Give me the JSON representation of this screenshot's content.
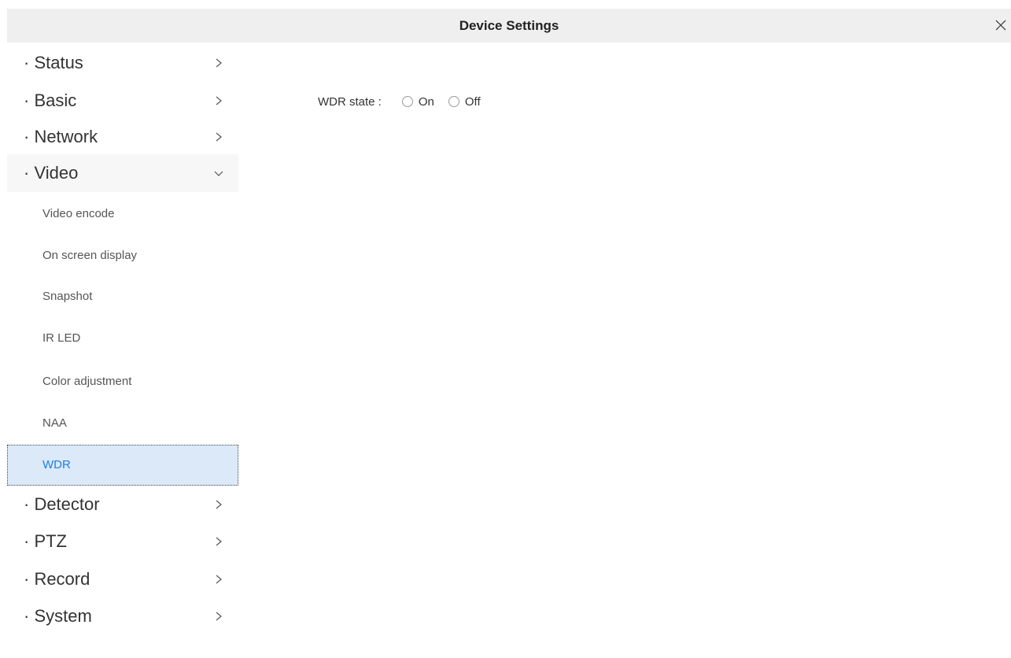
{
  "window": {
    "title": "Device Settings",
    "close_icon": "close-icon"
  },
  "sidebar": {
    "top_items": [
      {
        "label": "· Status",
        "arrow": "chevron-right-icon"
      },
      {
        "label": "· Basic",
        "arrow": "chevron-right-icon"
      },
      {
        "label": "· Network",
        "arrow": "chevron-right-icon"
      },
      {
        "label": "· Video",
        "arrow": "chevron-down-icon",
        "expanded": true
      }
    ],
    "video_sub_items": [
      {
        "label": "Video encode"
      },
      {
        "label": "On screen display"
      },
      {
        "label": "Snapshot"
      },
      {
        "label": "IR LED"
      },
      {
        "label": "Color adjustment"
      },
      {
        "label": "NAA"
      },
      {
        "label": "WDR",
        "active": true
      }
    ],
    "bottom_items": [
      {
        "label": "· Detector",
        "arrow": "chevron-right-icon"
      },
      {
        "label": "· PTZ",
        "arrow": "chevron-right-icon"
      },
      {
        "label": "· Record",
        "arrow": "chevron-right-icon"
      },
      {
        "label": "· System",
        "arrow": "chevron-right-icon"
      }
    ]
  },
  "wdr": {
    "label": "WDR state :",
    "options": [
      {
        "label": "On",
        "selected": false
      },
      {
        "label": "Off",
        "selected": false
      }
    ]
  },
  "colors": {
    "titlebar_bg": "#efefef",
    "active_bg": "#dbe9f9",
    "active_text": "#1b7fe3"
  }
}
